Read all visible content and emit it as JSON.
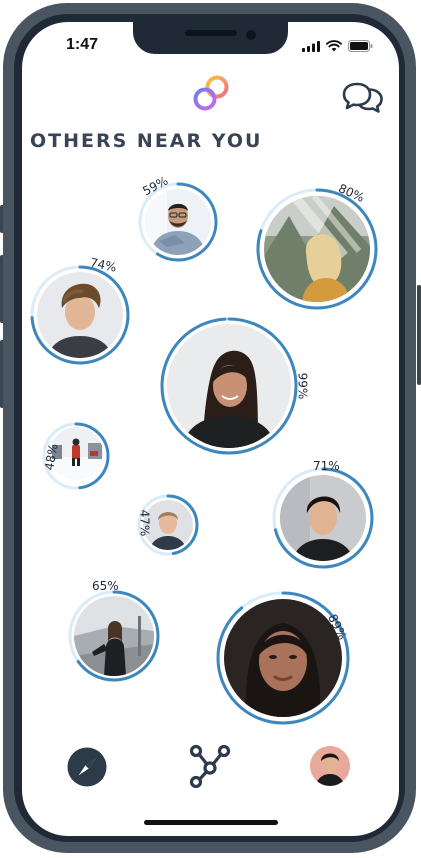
{
  "status_bar": {
    "time": "1:47"
  },
  "header": {
    "title": "OTHERS NEAR YOU",
    "logo_icon": "rings-logo-icon",
    "chat_icon": "chat-bubbles-icon"
  },
  "people": [
    {
      "id": "p59",
      "match": "59%",
      "match_value": 0.59,
      "photo": "man-glasses-blue-shirt"
    },
    {
      "id": "p80",
      "match": "80%",
      "match_value": 0.8,
      "photo": "woman-blonde-forest"
    },
    {
      "id": "p74",
      "match": "74%",
      "match_value": 0.74,
      "photo": "young-man-curly-hair"
    },
    {
      "id": "p99",
      "match": "99%",
      "match_value": 0.99,
      "photo": "woman-dark-hair-black-top"
    },
    {
      "id": "p48",
      "match": "48%",
      "match_value": 0.48,
      "photo": "person-walking-snow"
    },
    {
      "id": "p47",
      "match": "47%",
      "match_value": 0.47,
      "photo": "man-dark-shirt"
    },
    {
      "id": "p71",
      "match": "71%",
      "match_value": 0.71,
      "photo": "young-man-black-shirt"
    },
    {
      "id": "p65",
      "match": "65%",
      "match_value": 0.65,
      "photo": "man-long-hair-road"
    },
    {
      "id": "p89",
      "match": "89%",
      "match_value": 0.89,
      "photo": "woman-close-portrait"
    }
  ],
  "bottom_nav": {
    "items": [
      {
        "name": "explore",
        "icon": "compass-icon"
      },
      {
        "name": "connections",
        "icon": "network-icon"
      },
      {
        "name": "profile",
        "icon": "avatar"
      }
    ]
  },
  "colors": {
    "accent": "#3e87bd",
    "ring_glow": "#d9ecf8",
    "text": "#394554",
    "nav_dark": "#2c3a4a"
  }
}
